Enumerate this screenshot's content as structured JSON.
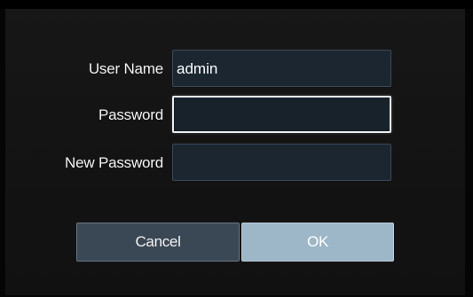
{
  "dialog": {
    "fields": [
      {
        "label": "User Name",
        "value": "admin",
        "placeholder": ""
      },
      {
        "label": "Password",
        "value": "",
        "placeholder": ""
      },
      {
        "label": "New Password",
        "value": "",
        "placeholder": ""
      }
    ],
    "buttons": {
      "cancel_label": "Cancel",
      "ok_label": "OK"
    }
  },
  "colors": {
    "background": "#131313",
    "field_background": "#1b2630",
    "cancel_button": "#3a4754",
    "ok_button": "#9db7c8",
    "focus_border": "#e8eef2"
  }
}
